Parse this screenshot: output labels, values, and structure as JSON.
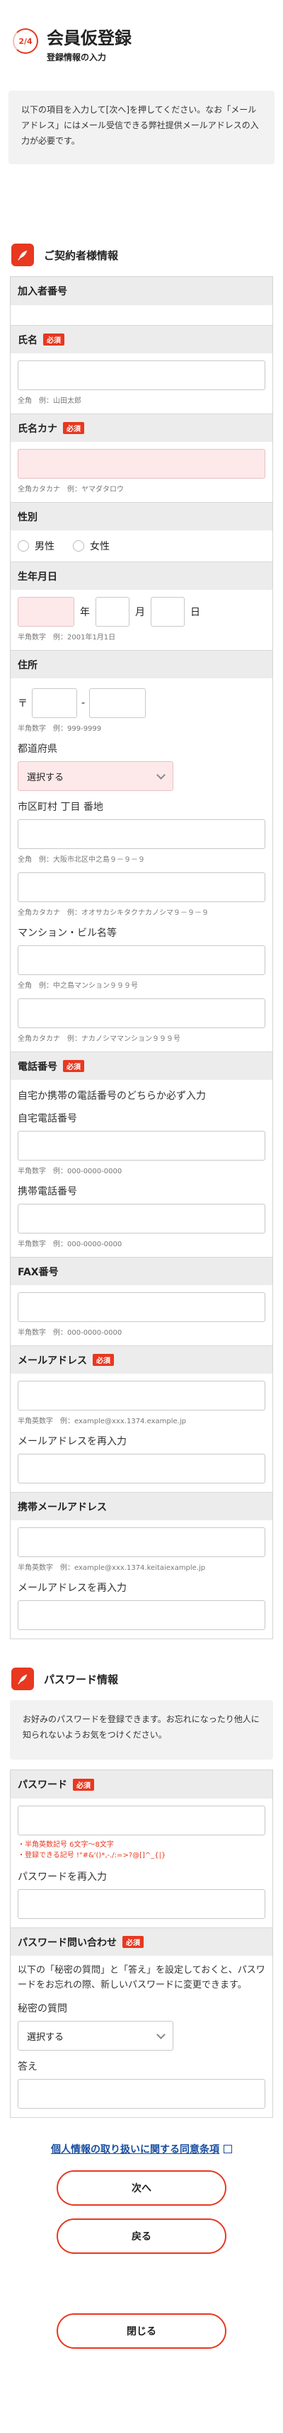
{
  "header": {
    "step": "2/4",
    "title": "会員仮登録",
    "subtitle": "登録情報の入力"
  },
  "intro": "以下の項目を入力して[次へ]を押してください。なお「メールアドレス」にはメール受信できる弊社提供メールアドレスの入力が必要です。",
  "contract": {
    "title": "ご契約者様情報",
    "required": "必須",
    "subscriber_no": "加入者番号",
    "name": "氏名",
    "name_hint": "全角　例：山田太郎",
    "kana": "氏名カナ",
    "kana_hint": "全角カタカナ　例：ヤマダタロウ",
    "gender": "性別",
    "male": "男性",
    "female": "女性",
    "dob": "生年月日",
    "year": "年",
    "month": "月",
    "day": "日",
    "dob_hint": "半角数字　例：2001年1月1日",
    "address": "住所",
    "zip_mark": "〒",
    "zip_dash": "-",
    "zip_hint": "半角数字　例：999-9999",
    "pref_label": "都道府県",
    "pref_value": "選択する",
    "city_label": "市区町村 丁目 番地",
    "city_hint": "全角　例：大阪市北区中之島９－９－９",
    "city_kana_hint": "全角カタカナ　例：オオサカシキタクナカノシマ９－９－９",
    "building_label": "マンション・ビル名等",
    "building_hint": "全角　例：中之島マンション９９９号",
    "building_kana_hint": "全角カタカナ　例：ナカノシママンション９９９号",
    "phone": "電話番号",
    "phone_note": "自宅か携帯の電話番号のどちらか必ず入力",
    "home_phone": "自宅電話番号",
    "home_phone_hint": "半角数字　例：000-0000-0000",
    "mobile_phone": "携帯電話番号",
    "mobile_phone_hint": "半角数字　例：000-0000-0000",
    "fax": "FAX番号",
    "fax_hint": "半角数字　例：000-0000-0000",
    "email": "メールアドレス",
    "email_hint": "半角英数字　例：example@xxx.1374.example.jp",
    "email_confirm": "メールアドレスを再入力",
    "mobile_email": "携帯メールアドレス",
    "mobile_email_hint": "半角英数字　例：example@xxx.1374.keitaiexample.jp",
    "mobile_email_confirm": "メールアドレスを再入力"
  },
  "password": {
    "title": "パスワード情報",
    "intro": "お好みのパスワードを登録できます。お忘れになったり他人に知られないようお気をつけください。",
    "required": "必須",
    "password": "パスワード",
    "rule1": "・半角英数記号 6文字～8文字",
    "rule2": "・登録できる記号 !\"#&'()*,-./:=>?@[]^_{|}",
    "confirm": "パスワードを再入力",
    "inquiry": "パスワード問い合わせ",
    "inquiry_text": "以下の「秘密の質問」と「答え」を設定しておくと、パスワードをお忘れの際、新しいパスワードに変更できます。",
    "question": "秘密の質問",
    "question_value": "選択する",
    "answer": "答え"
  },
  "footer": {
    "privacy_link": "個人情報の取り扱いに関する同意条項",
    "next": "次へ",
    "back": "戻る",
    "close": "閉じる"
  },
  "colors": {
    "accent": "#e83820",
    "link": "#1a4fa0",
    "required_field": "#fde8ea"
  }
}
